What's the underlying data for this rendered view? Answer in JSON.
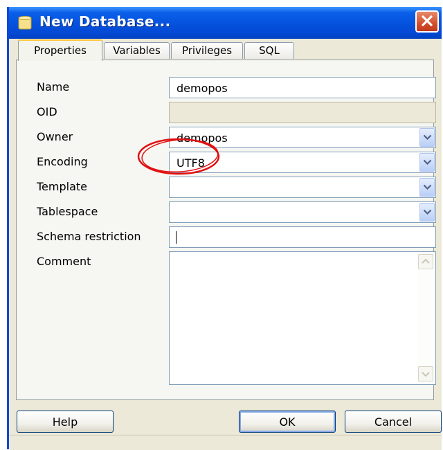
{
  "window": {
    "title": "New Database..."
  },
  "tabs": [
    {
      "label": "Properties"
    },
    {
      "label": "Variables"
    },
    {
      "label": "Privileges"
    },
    {
      "label": "SQL"
    }
  ],
  "form": {
    "name": {
      "label": "Name",
      "value": "demopos"
    },
    "oid": {
      "label": "OID",
      "value": ""
    },
    "owner": {
      "label": "Owner",
      "value": "demopos"
    },
    "encoding": {
      "label": "Encoding",
      "value": "UTF8"
    },
    "template": {
      "label": "Template",
      "value": ""
    },
    "tablespace": {
      "label": "Tablespace",
      "value": ""
    },
    "schema_restriction": {
      "label": "Schema restriction",
      "value": ""
    },
    "comment": {
      "label": "Comment",
      "value": ""
    }
  },
  "buttons": {
    "help": "Help",
    "ok": "OK",
    "cancel": "Cancel"
  },
  "colors": {
    "titlebar": "#0553DE",
    "annotation": "#E01010",
    "dialog_bg": "#ECE9D8"
  }
}
